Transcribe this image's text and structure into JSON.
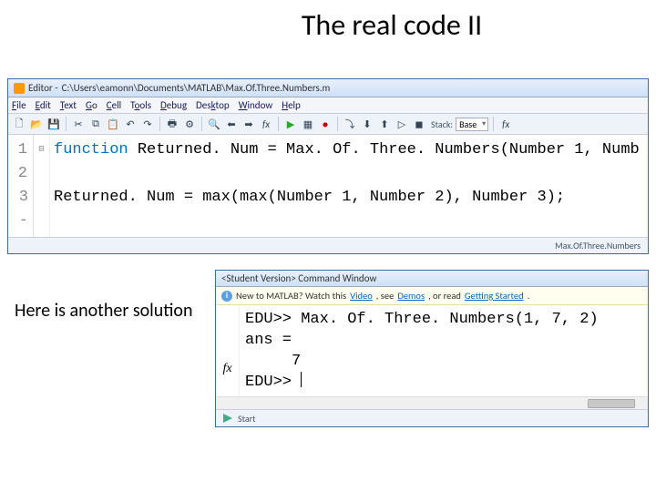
{
  "slide": {
    "title": "The real code II",
    "caption": "Here is another solution"
  },
  "editor": {
    "title_prefix": "Editor - ",
    "path": "C:\\Users\\eamonn\\Documents\\MATLAB\\Max.Of.Three.Numbers.m",
    "status_file": "Max.Of.Three.Numbers",
    "menu": {
      "file": "File",
      "edit": "Edit",
      "text": "Text",
      "go": "Go",
      "cell": "Cell",
      "tools": "Tools",
      "debug": "Debug",
      "desktop": "Desktop",
      "window": "Window",
      "help": "Help"
    },
    "toolbar": {
      "stack_label": "Stack:",
      "stack_value": "Base",
      "fx": "fx"
    },
    "gutter": [
      "1",
      "2",
      "3 -"
    ],
    "fold": [
      "⊟",
      " ",
      " "
    ],
    "code": {
      "line1_kw": "function ",
      "line1_rest": "Returned. Num = Max. Of. Three. Numbers(Number 1, Numb",
      "line2": "",
      "line3": "Returned. Num = max(max(Number 1, Number 2), Number 3);"
    }
  },
  "command": {
    "title": "<Student Version> Command Window",
    "banner": {
      "prefix": "New to MATLAB? Watch this ",
      "link1": "Video",
      "mid1": ", see ",
      "link2": "Demos",
      "mid2": ", or read ",
      "link3": "Getting Started",
      "suffix": "."
    },
    "lines": {
      "l1": "EDU>> Max. Of. Three. Numbers(1, 7, 2)",
      "l2": "ans =",
      "l3": "     7",
      "l4": "EDU>> "
    },
    "fx": "fx",
    "status": "Start"
  }
}
